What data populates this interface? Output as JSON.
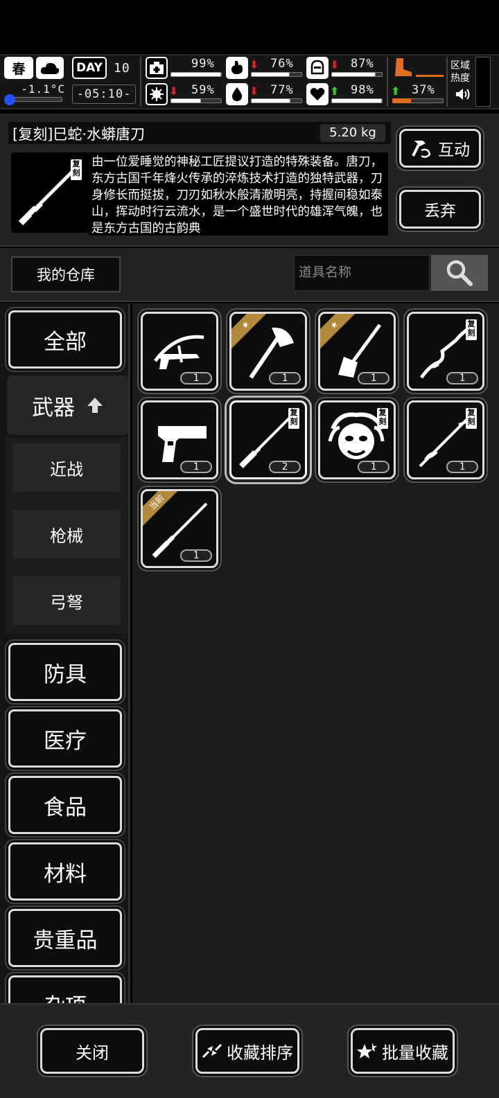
{
  "status": {
    "season": "春",
    "day_label": "DAY",
    "day_number": "10",
    "temperature": "-1.1°C",
    "time": "-05:10-",
    "stats": [
      {
        "name": "health",
        "value": "99%",
        "trend": "",
        "fill": 0.99
      },
      {
        "name": "hunger",
        "value": "76%",
        "trend": "down",
        "fill": 0.76
      },
      {
        "name": "armor",
        "value": "87%",
        "trend": "down",
        "fill": 0.87
      },
      {
        "name": "virus",
        "value": "59%",
        "trend": "down",
        "fill": 0.59
      },
      {
        "name": "thirst",
        "value": "77%",
        "trend": "down",
        "fill": 0.77
      },
      {
        "name": "heart",
        "value": "98%",
        "trend": "up",
        "fill": 0.98
      },
      {
        "name": "stamina",
        "value": "37%",
        "trend": "up",
        "fill": 0.37
      }
    ],
    "region_heat_label": "区域热度"
  },
  "item": {
    "title": "[复刻]巳蛇·水蟒唐刀",
    "weight": "5.20 kg",
    "description": "由一位爱睡觉的神秘工匠提议打造的特殊装备。唐刀，东方古国千年烽火传承的淬炼技术打造的独特武器，刀身修长而挺拔，刀刃如秋水般清澈明亮，持握间稳如泰山，挥动时行云流水，是一个盛世时代的雄浑气魄，也是东方古国的古韵典",
    "tag": "复刻",
    "interact_label": "互动",
    "discard_label": "丢弃"
  },
  "warehouse": {
    "title": "我的仓库",
    "search_placeholder": "道具名称"
  },
  "categories": [
    {
      "label": "全部"
    },
    {
      "label": "武器"
    },
    {
      "label": "防具"
    },
    {
      "label": "医疗"
    },
    {
      "label": "食品"
    },
    {
      "label": "材料"
    },
    {
      "label": "贵重品"
    },
    {
      "label": "杂项"
    }
  ],
  "subcategories": [
    {
      "label": "近战"
    },
    {
      "label": "枪械"
    },
    {
      "label": "弓弩"
    }
  ],
  "items": [
    {
      "name": "crossbow",
      "count": "1",
      "badge": "",
      "ribbon": ""
    },
    {
      "name": "axe",
      "count": "1",
      "badge": "",
      "ribbon": "★"
    },
    {
      "name": "shovel",
      "count": "1",
      "badge": "",
      "ribbon": "★"
    },
    {
      "name": "serpent-blade",
      "count": "1",
      "badge": "复刻",
      "ribbon": ""
    },
    {
      "name": "desert-eagle",
      "count": "1",
      "badge": "",
      "ribbon": ""
    },
    {
      "name": "tang-dao",
      "count": "2",
      "badge": "复刻",
      "ribbon": ""
    },
    {
      "name": "medusa-mask",
      "count": "1",
      "badge": "复刻",
      "ribbon": ""
    },
    {
      "name": "serpent-staff",
      "count": "1",
      "badge": "复刻",
      "ribbon": ""
    },
    {
      "name": "katana",
      "count": "1",
      "badge": "",
      "ribbon": "当前"
    }
  ],
  "bottom": {
    "close_label": "关闭",
    "sort_label": "收藏排序",
    "batch_label": "批量收藏"
  }
}
